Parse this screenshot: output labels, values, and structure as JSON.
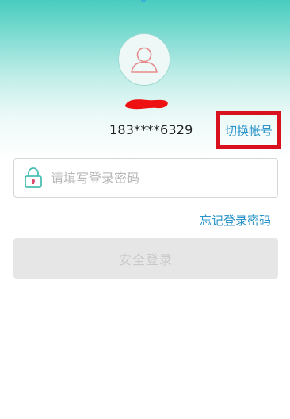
{
  "profile": {
    "avatar_icon": "user-silhouette-icon",
    "name_redacted": true,
    "phone": "183****6329"
  },
  "actions": {
    "switch_account_label": "切换帐号",
    "forgot_password_label": "忘记登录密码"
  },
  "password": {
    "icon": "lock-icon",
    "placeholder": "请填写登录密码",
    "value": ""
  },
  "login": {
    "label": "安全登录",
    "enabled": false
  },
  "colors": {
    "header_gradient_top": "#48ccbf",
    "link": "#2a93c9",
    "highlight_box": "#d9101e",
    "button_disabled_bg": "#e6e6e6",
    "button_disabled_text": "#c9c9c9",
    "lock_accent": "#e0476a"
  }
}
